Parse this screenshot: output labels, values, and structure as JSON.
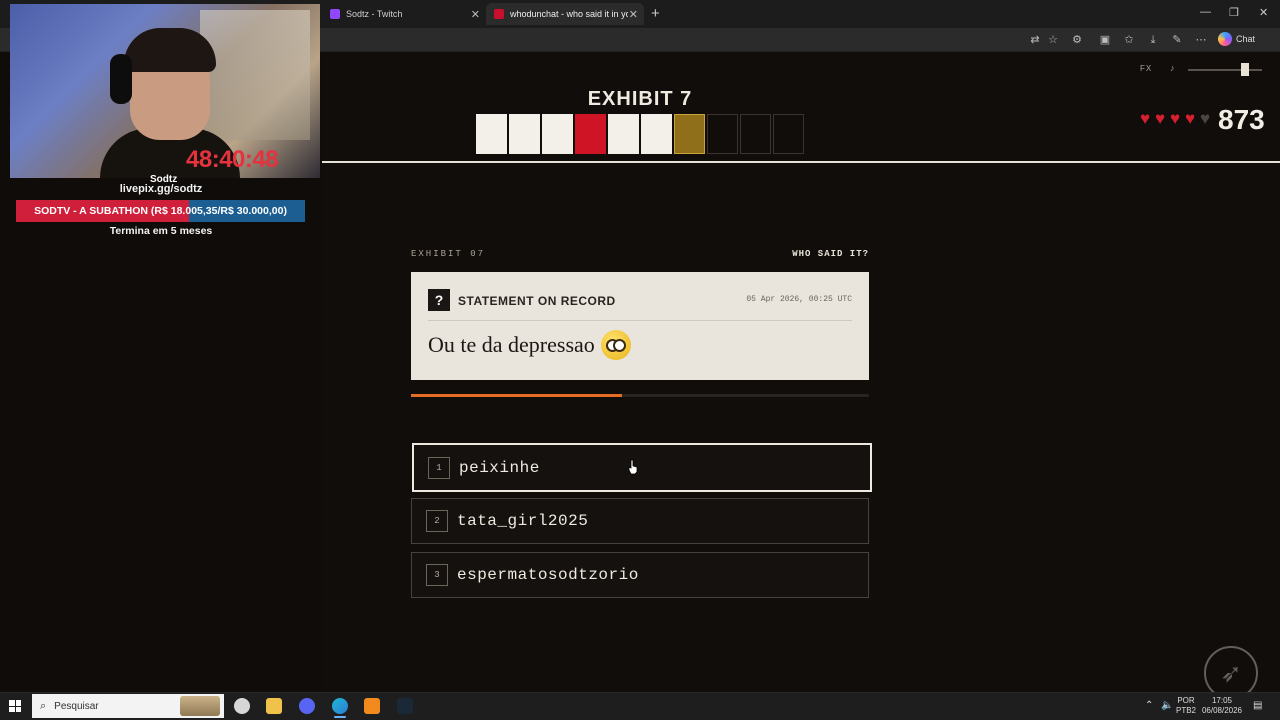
{
  "browser": {
    "tabs": [
      {
        "label": "Sodtz - Twitch"
      },
      {
        "label": "whodunchat - who said it in your chat"
      }
    ],
    "new_tab": "+",
    "chat_label": "Chat"
  },
  "game": {
    "exhibit_title": "EXHIBIT 7",
    "progress": [
      "white",
      "white",
      "white",
      "red",
      "white",
      "white",
      "gold",
      "empty",
      "empty",
      "empty"
    ],
    "fx_label": "FX",
    "volume": 0.75,
    "hearts_full": 4,
    "hearts_total": 5,
    "score": "873",
    "exhibit_label": "EXHIBIT 07",
    "who_label": "WHO SAID IT?",
    "card": {
      "q_mark": "?",
      "title": "STATEMENT ON RECORD",
      "date": "05 Apr 2026, 00:25 UTC",
      "quote": "Ou te da depressao"
    },
    "timer_remaining": 0.46,
    "options": [
      {
        "num": "1",
        "name": "peixinhe",
        "selected": true
      },
      {
        "num": "2",
        "name": "tata_girl2025",
        "selected": false
      },
      {
        "num": "3",
        "name": "espermatosodtzorio",
        "selected": false
      }
    ]
  },
  "stream_overlay": {
    "timer": "48:40:48",
    "cam_tag": "Sodtz",
    "livepix": "livepix.gg/sodtz",
    "subathon_text": "SODTV - A SUBATHON (R$ 18.005,35/R$ 30.000,00)",
    "subathon_progress": 0.6,
    "ends_in": "Termina em 5 meses"
  },
  "taskbar": {
    "search_placeholder": "Pesquisar",
    "lang_top": "POR",
    "lang_bottom": "PTB2",
    "time": "17:05",
    "date": "06/08/2026"
  }
}
